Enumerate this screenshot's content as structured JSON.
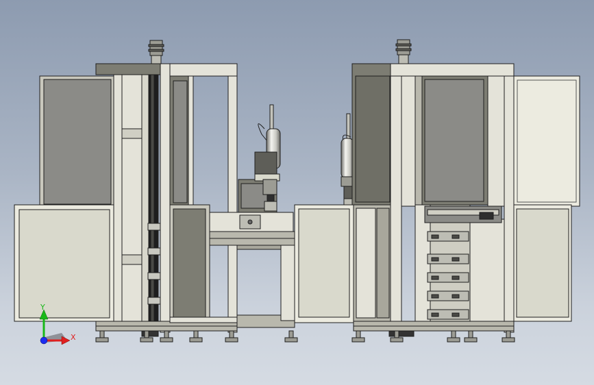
{
  "viewport": {
    "background_top": "#8d9bb0",
    "background_bottom": "#d5dbe3"
  },
  "triad": {
    "x_label": "X",
    "y_label": "Y",
    "x_color": "#e02020",
    "y_color": "#18b818",
    "z_color": "#1c2cf0"
  },
  "colors": {
    "frame_light": "#e4e3d9",
    "frame_mid": "#b9b8ad",
    "panel_dark": "#7d7d73",
    "panel_gray": "#8b8b87",
    "panel_cream": "#d9d9cc",
    "panel_white": "#ecebe0",
    "outline": "#1e1e1e"
  }
}
